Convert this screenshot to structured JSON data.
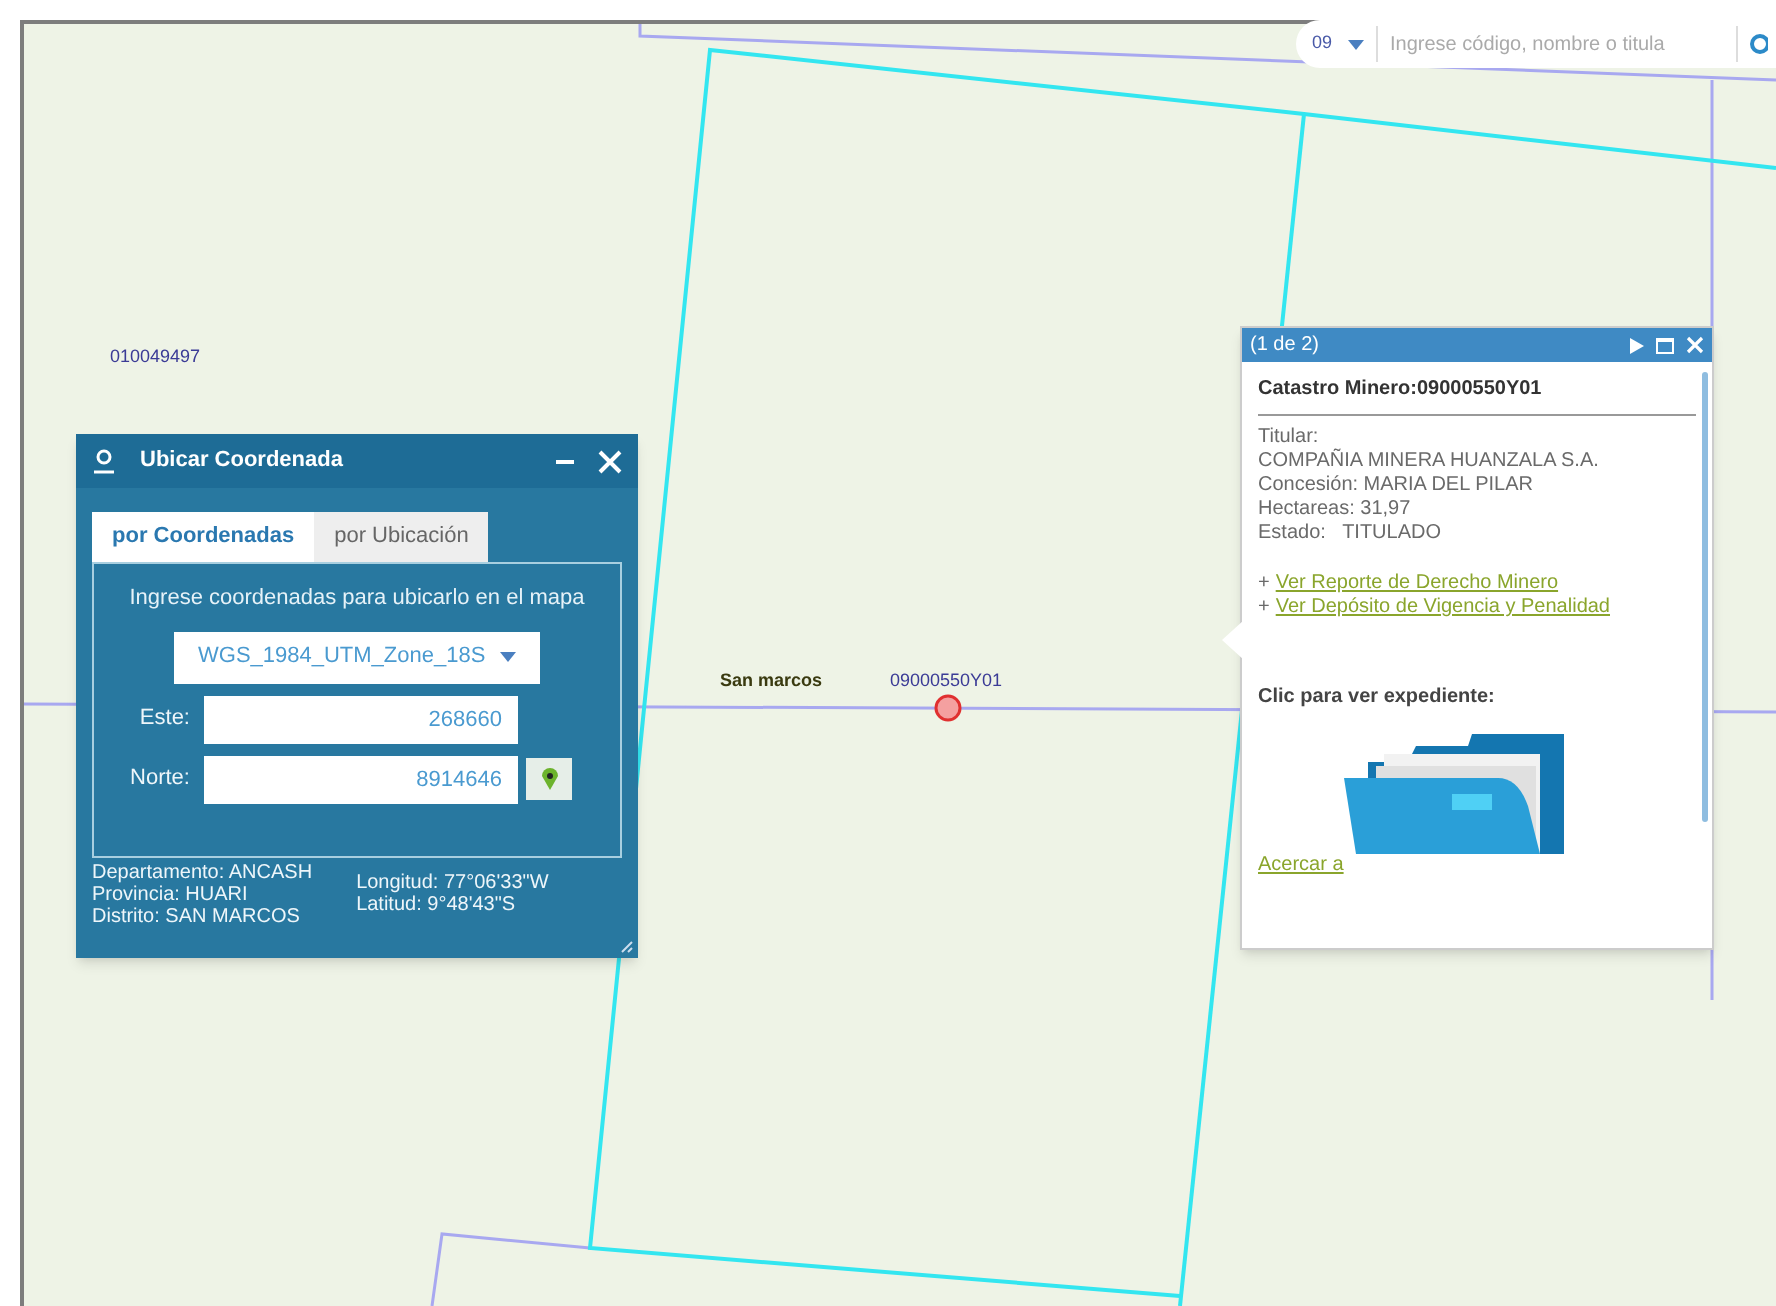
{
  "search": {
    "prefix": "09",
    "placeholder": "Ingrese código, nombre o titula"
  },
  "map_labels": [
    {
      "text": "010049497",
      "kind": "code"
    },
    {
      "text": "San marcos",
      "kind": "place"
    },
    {
      "text": "09000550Y01",
      "kind": "code"
    }
  ],
  "locate_panel": {
    "title": "Ubicar Coordenada",
    "tabs": [
      {
        "label": "por Coordenadas",
        "selected": true
      },
      {
        "label": "por Ubicación",
        "selected": false
      }
    ],
    "instruction": "Ingrese coordenadas para ubicarlo en el mapa",
    "projection": "WGS_1984_UTM_Zone_18S",
    "fields": [
      {
        "label": "Este:",
        "value": "268660"
      },
      {
        "label": "Norte:",
        "value": "8914646"
      }
    ],
    "location": [
      "Departamento: ANCASH",
      "Provincia: HUARI",
      "Distrito: SAN MARCOS"
    ],
    "coordinates": [
      "Longitud: 77°06'33\"W",
      "Latitud: 9°48'43\"S"
    ]
  },
  "popup": {
    "pager": "(1 de 2)",
    "title": "Catastro Minero:09000550Y01",
    "details": [
      "Titular:",
      "COMPAÑIA MINERA HUANZALA S.A.",
      "Concesión: MARIA DEL PILAR",
      "Hectareas: 31,97",
      "Estado:   TITULADO"
    ],
    "links": [
      {
        "prefix": "+",
        "text": "Ver Reporte de Derecho Minero"
      },
      {
        "prefix": "+",
        "text": "Ver Depósito de Vigencia y Penalidad"
      }
    ],
    "expediente_label": "Clic para ver expediente:",
    "zoom_link": "Acercar a"
  }
}
